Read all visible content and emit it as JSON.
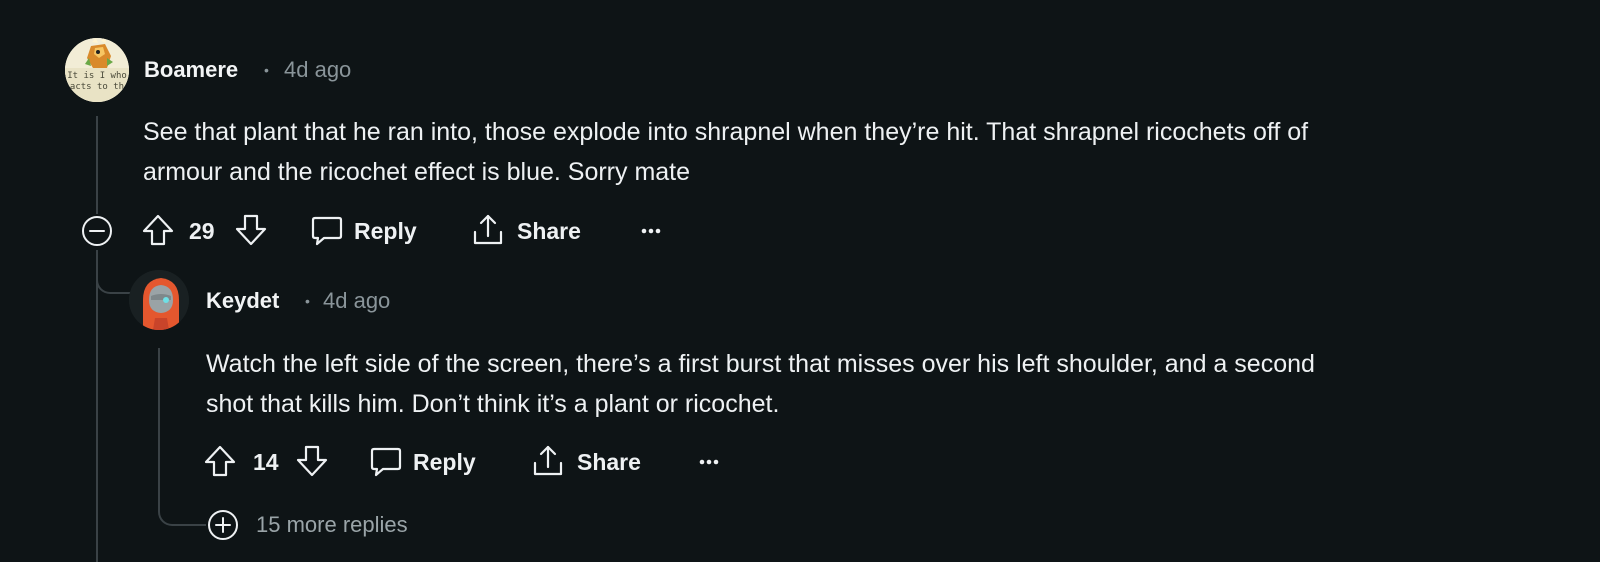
{
  "comment1": {
    "author": "Boamere",
    "separator": "•",
    "time": "4d ago",
    "avatar_text": "It is I who\nacts to th",
    "body_line1": "See that plant that he ran into, those explode into shrapnel when they’re hit. That shrapnel ricochets off of",
    "body_line2": "armour and the ricochet effect is blue. Sorry mate",
    "votes": "29",
    "reply_label": "Reply",
    "share_label": "Share",
    "overflow_label": "•••"
  },
  "comment2": {
    "author": "Keydet",
    "separator": "•",
    "time": "4d ago",
    "body_line1": "Watch the left side of the screen, there’s a first burst that misses over his left shoulder, and a second",
    "body_line2": "shot that kills him. Don’t think it’s a plant or ricochet.",
    "votes": "14",
    "reply_label": "Reply",
    "share_label": "Share",
    "overflow_label": "•••",
    "more_replies_label": "15 more replies"
  },
  "icons": {
    "collapse": "minus-circle-icon",
    "expand": "plus-circle-icon",
    "upvote": "arrow-up-icon",
    "downvote": "arrow-down-icon",
    "reply": "speech-bubble-icon",
    "share": "share-icon",
    "more": "ellipsis-icon"
  },
  "colors": {
    "background": "#0e1416",
    "text": "#eef1f3",
    "muted": "#8a959a",
    "thread_line": "#3a4246",
    "avatar2_accent": "#e4572e"
  }
}
